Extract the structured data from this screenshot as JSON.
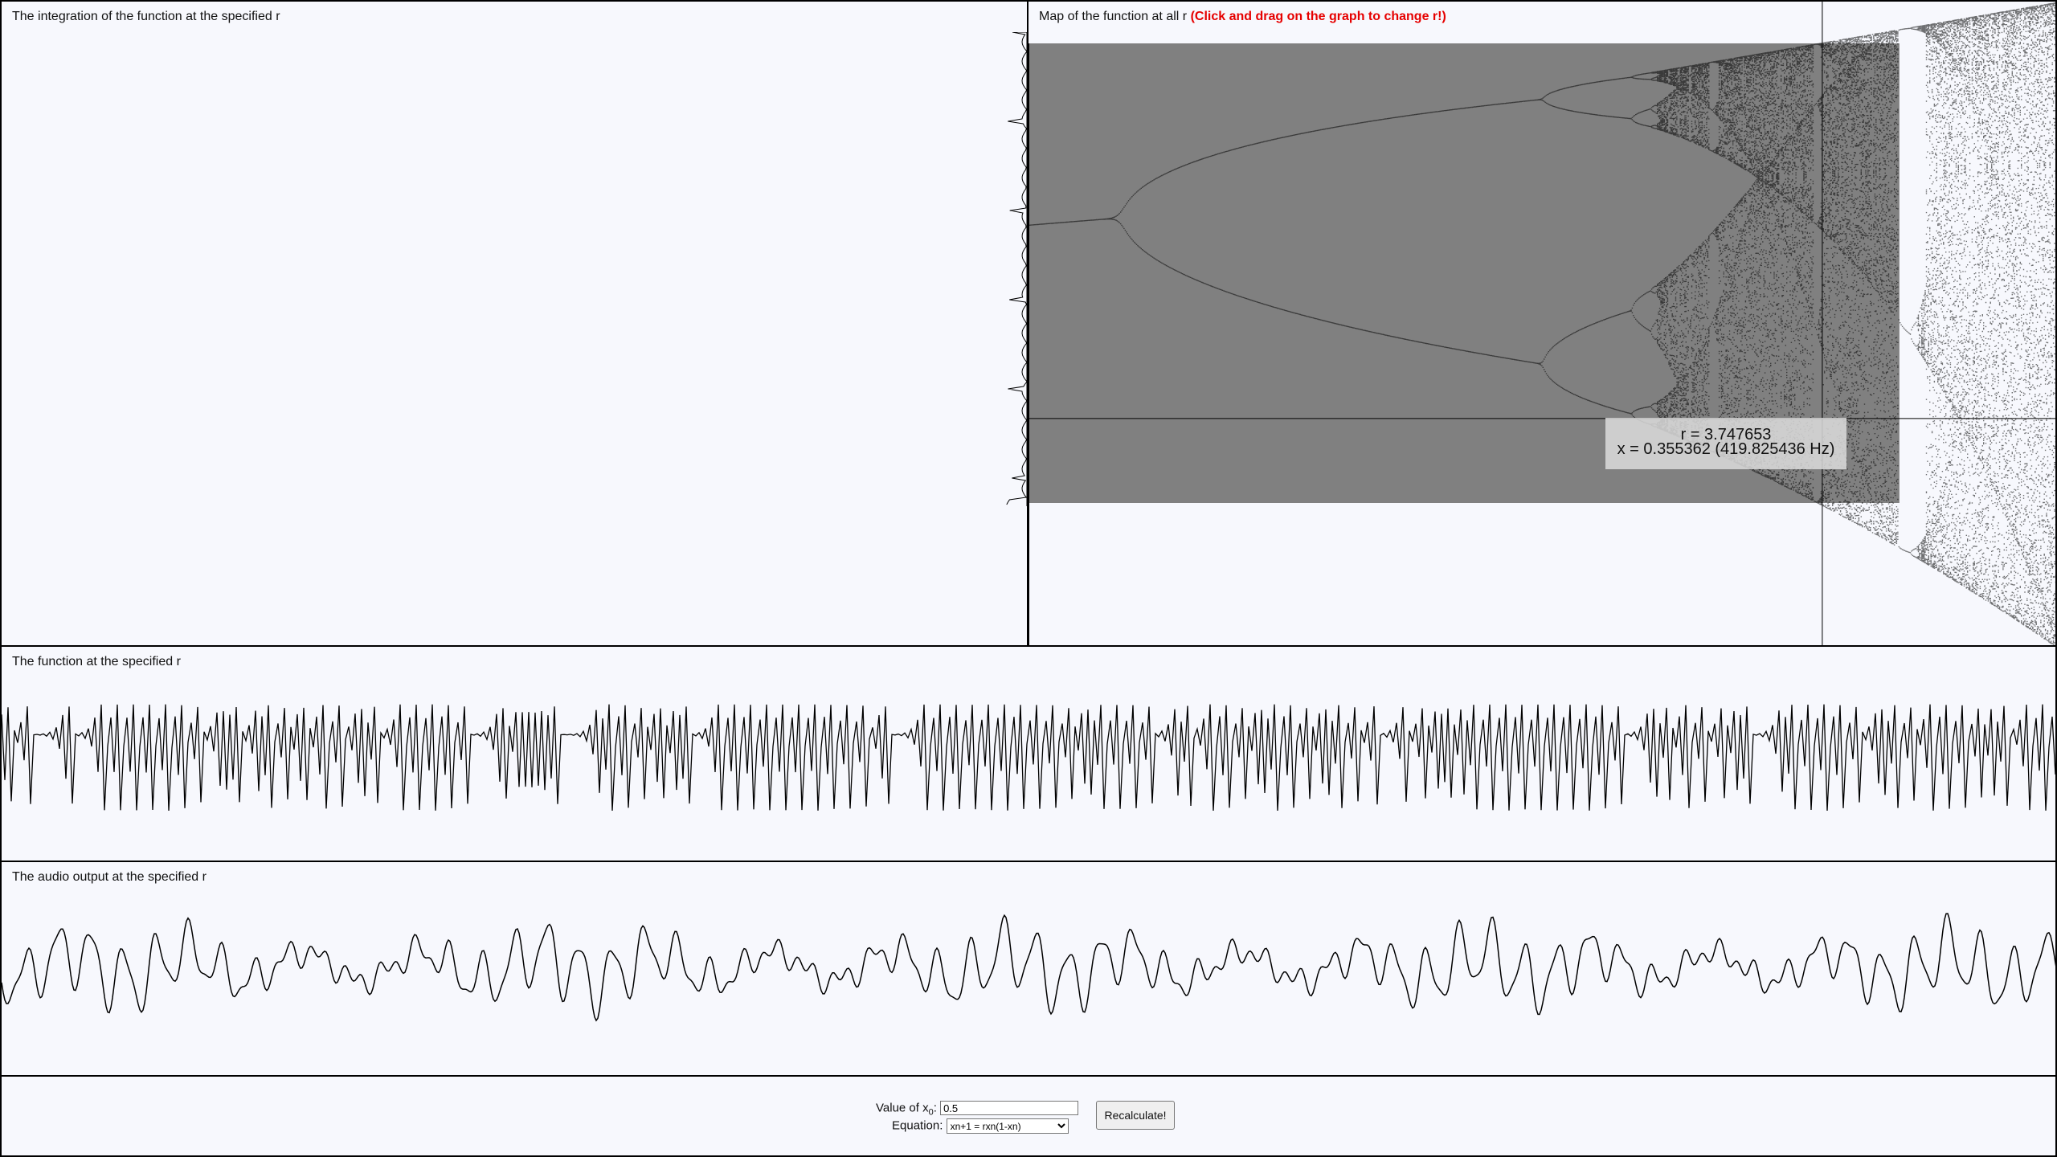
{
  "panels": {
    "integration": {
      "title": "The integration of the function at the specified r"
    },
    "map": {
      "title": "Map of the function at all r",
      "hint": "(Click and drag on the graph to change r!)"
    },
    "function": {
      "title": "The function at the specified r"
    },
    "audio": {
      "title": "The audio output at the specified r"
    }
  },
  "readout": {
    "r_text": "r = 3.747653",
    "x_text": "x = 0.355362 (419.825436 Hz)"
  },
  "selected_r": 3.747653,
  "selected_x": 0.355362,
  "controls": {
    "x0_label": "Value of x",
    "x0_subscript": "0",
    "x0_colon": ":",
    "x0_value": "0.5",
    "equation_label": "Equation:",
    "equation_selected": "xn+1 = rxn(1-xn)",
    "recalc_label": "Recalculate!"
  },
  "colors": {
    "panel_bg": "#f7f8fd",
    "zoom_region": "#808080",
    "hint": "#e60000",
    "trace": "#000000"
  }
}
